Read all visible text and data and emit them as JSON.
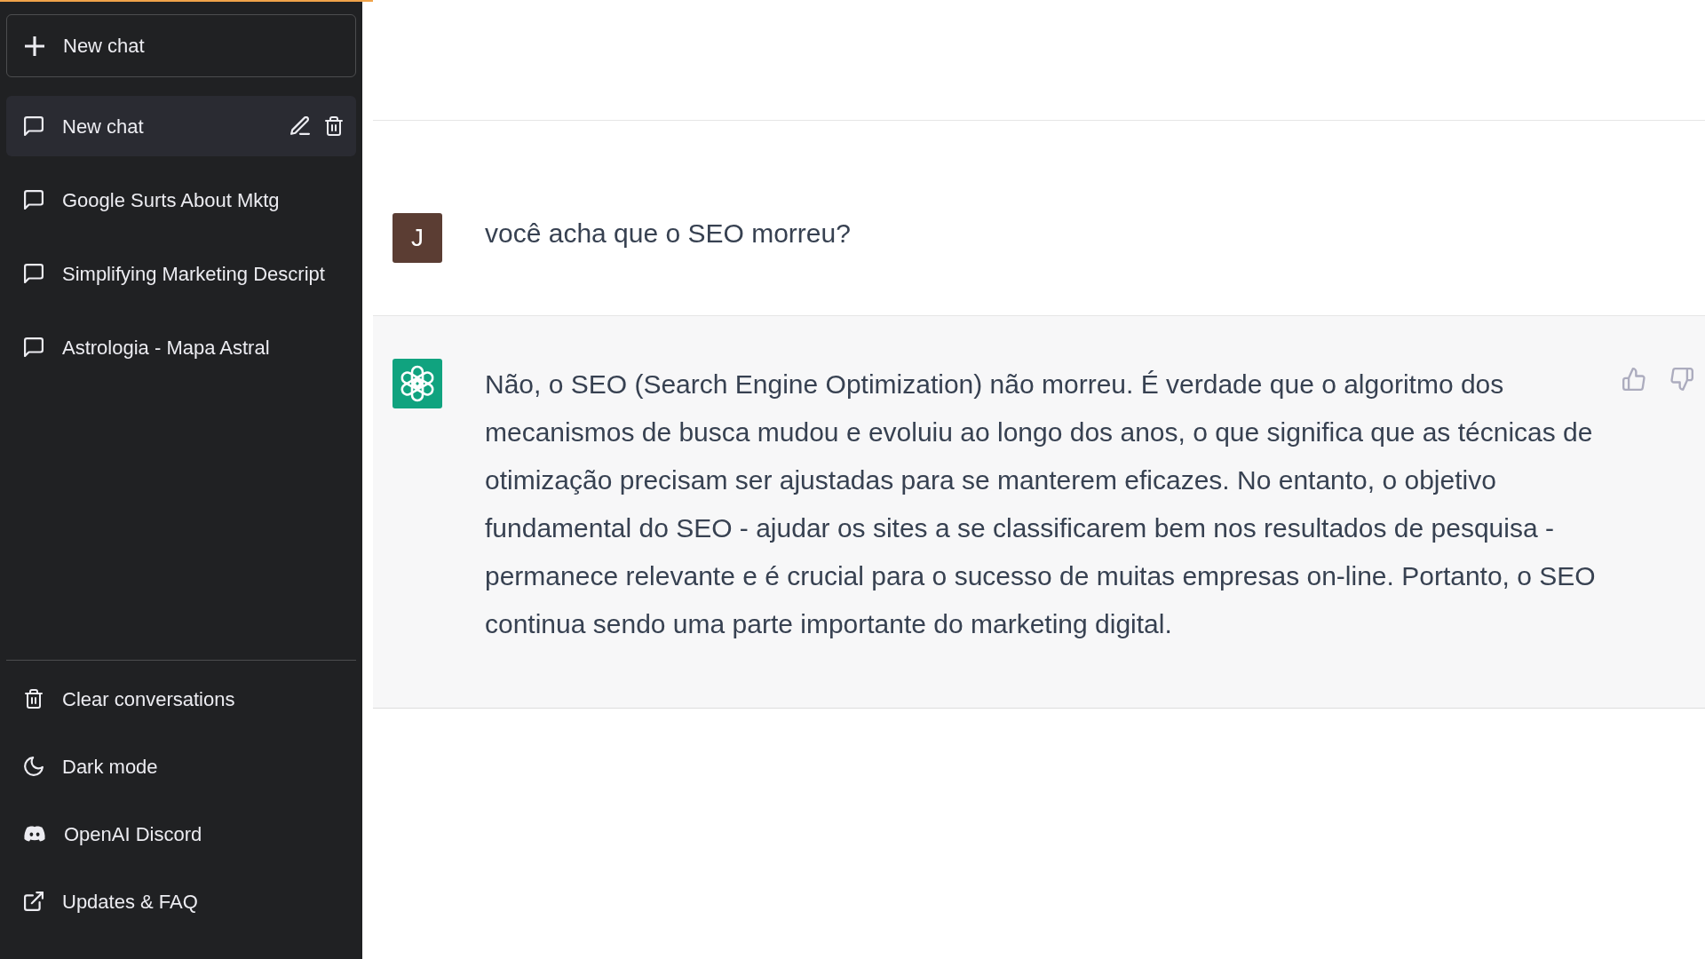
{
  "sidebar": {
    "new_chat_button": {
      "label": "New chat"
    },
    "conversations": [
      {
        "title": "New chat",
        "selected": true
      },
      {
        "title": "Google Surts About Mktg",
        "selected": false
      },
      {
        "title": "Simplifying Marketing Descript",
        "selected": false
      },
      {
        "title": "Astrologia - Mapa Astral",
        "selected": false
      }
    ],
    "menu": [
      {
        "kind": "clear",
        "label": "Clear conversations"
      },
      {
        "kind": "theme",
        "label": "Dark mode"
      },
      {
        "kind": "discord",
        "label": "OpenAI Discord"
      },
      {
        "kind": "link",
        "label": "Updates & FAQ"
      }
    ]
  },
  "messages": [
    {
      "kind": "user",
      "avatar_letter": "J",
      "text": "você acha que o SEO morreu?"
    },
    {
      "kind": "assistant",
      "text": "Não, o SEO (Search Engine Optimization) não morreu. É verdade que o algoritmo dos mecanismos de busca mudou e evoluiu ao longo dos anos, o que significa que as técnicas de otimização precisam ser ajustadas para se manterem eficazes. No entanto, o objetivo fundamental do SEO - ajudar os sites a se classificarem bem nos resultados de pesquisa - permanece relevante e é crucial para o sucesso de muitas empresas on-line. Portanto, o SEO continua sendo uma parte importante do marketing digital."
    }
  ]
}
